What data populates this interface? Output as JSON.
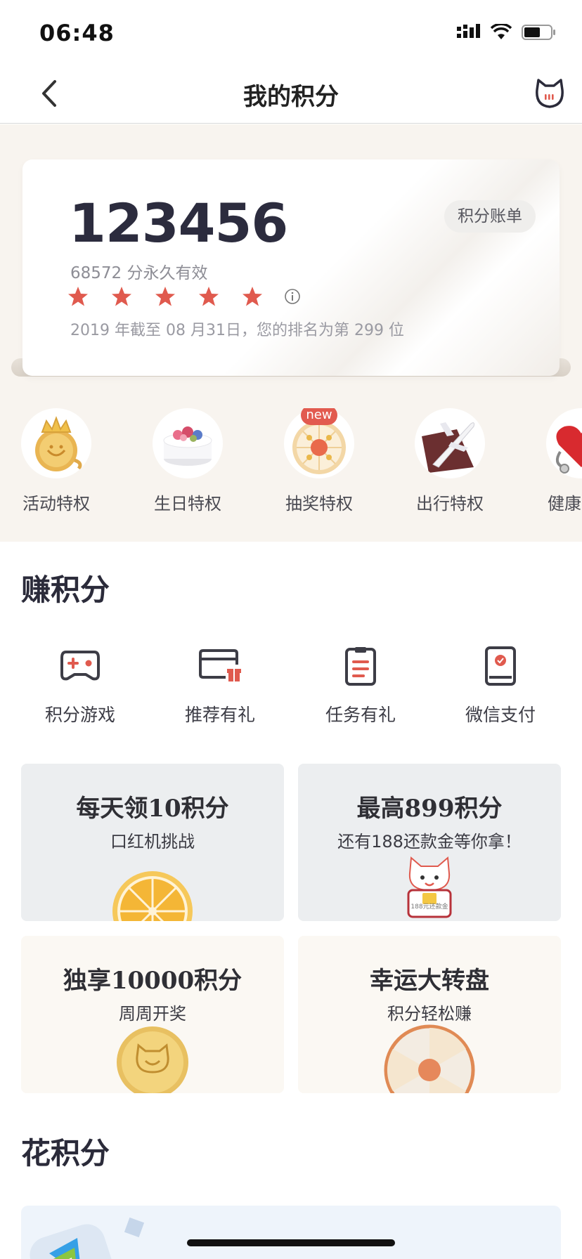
{
  "status_bar": {
    "time": "06:48"
  },
  "nav": {
    "title": "我的积分"
  },
  "points_card": {
    "total": "123456",
    "permanent": "68572 分永久有效",
    "stars": 5,
    "rank_text": "2019 年截至 08 月31日，您的排名为第 299 位",
    "bill_button": "积分账单"
  },
  "privileges": [
    {
      "label": "活动特权",
      "icon": "crown-coin-icon"
    },
    {
      "label": "生日特权",
      "icon": "birthday-cake-icon"
    },
    {
      "label": "抽奖特权",
      "icon": "lottery-wheel-icon",
      "badge": "new"
    },
    {
      "label": "出行特权",
      "icon": "airplane-icon"
    },
    {
      "label": "健康",
      "icon": "heart-stethoscope-icon"
    }
  ],
  "earn": {
    "title": "赚积分",
    "actions": [
      {
        "label": "积分游戏",
        "icon": "gamepad-icon"
      },
      {
        "label": "推荐有礼",
        "icon": "gift-card-icon"
      },
      {
        "label": "任务有礼",
        "icon": "clipboard-icon"
      },
      {
        "label": "微信支付",
        "icon": "payment-book-icon"
      }
    ],
    "promos": [
      {
        "title": "每天领10积分",
        "subtitle": "口红机挑战",
        "icon": "orange-slice-icon"
      },
      {
        "title": "最高899积分",
        "subtitle": "还有188还款金等你拿！",
        "icon": "cat-mascot-icon",
        "art_text": "188元还款金"
      },
      {
        "title": "独享10000积分",
        "subtitle": "周周开奖",
        "icon": "cat-coin-icon"
      },
      {
        "title": "幸运大转盘",
        "subtitle": "积分轻松赚",
        "icon": "spin-wheel-icon"
      }
    ]
  },
  "spend": {
    "title": "花积分",
    "icon": "video-play-icon"
  },
  "colors": {
    "accent_red": "#e05a4e",
    "beige_bg": "#f8f4ef",
    "text_dark": "#2b2b3a"
  }
}
